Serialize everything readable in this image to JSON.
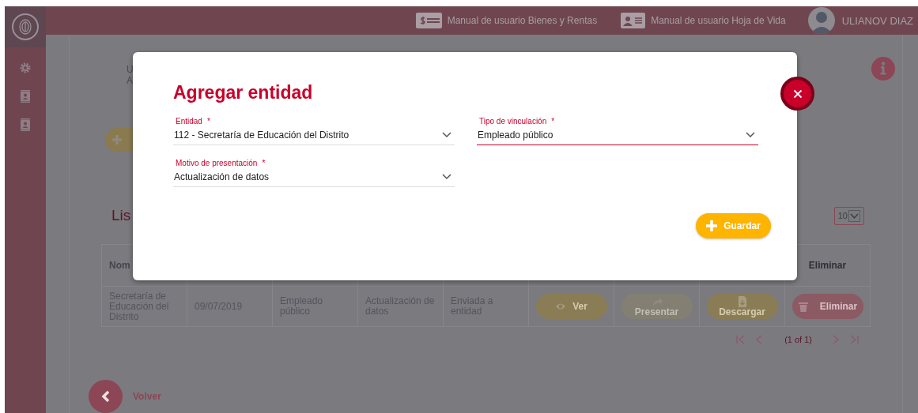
{
  "header": {
    "links": [
      {
        "label": "Manual de usuario Bienes y Rentas",
        "kind": "money"
      },
      {
        "label": "Manual de usuario Hoja de Vida",
        "kind": "card"
      }
    ],
    "user": "ULIANOV DIAZ"
  },
  "sidebar": {
    "items": [
      {
        "kind": "gear"
      },
      {
        "kind": "badge"
      },
      {
        "kind": "badge"
      }
    ]
  },
  "page": {
    "intro_lines": [
      "U",
      "A"
    ],
    "list_title": "Lis",
    "page_size": "10",
    "table": {
      "columns": [
        {
          "label": "Nom"
        },
        {
          "label": "Eliminar"
        }
      ],
      "rows": [
        {
          "cells": [
            "Secretaría de Educación del Distrito",
            "09/07/2019",
            "Empleado público",
            "Actualización de datos",
            "Enviada a entidad"
          ],
          "actions": [
            {
              "label": "Ver",
              "kind": "view",
              "disabled": false
            },
            {
              "label": "Presentar",
              "kind": "present",
              "disabled": true
            },
            {
              "label": "Descargar",
              "kind": "download",
              "disabled": false
            },
            {
              "label": "Eliminar",
              "kind": "delete",
              "disabled": false
            }
          ]
        }
      ]
    },
    "pagination": "(1 of 1)",
    "back": "Volver"
  },
  "modal": {
    "title": "Agregar entidad",
    "fields": [
      {
        "label": "Entidad",
        "mark": "*",
        "value": "112 - Secretaría de Educación del Distrito",
        "focused": false
      },
      {
        "label": "Tipo de vinculación",
        "mark": "*",
        "value": "Empleado público",
        "focused": true
      },
      {
        "label": "Motivo de presentación",
        "mark": "*",
        "value": "Actualización de datos",
        "focused": false
      }
    ],
    "save": "Guardar"
  }
}
